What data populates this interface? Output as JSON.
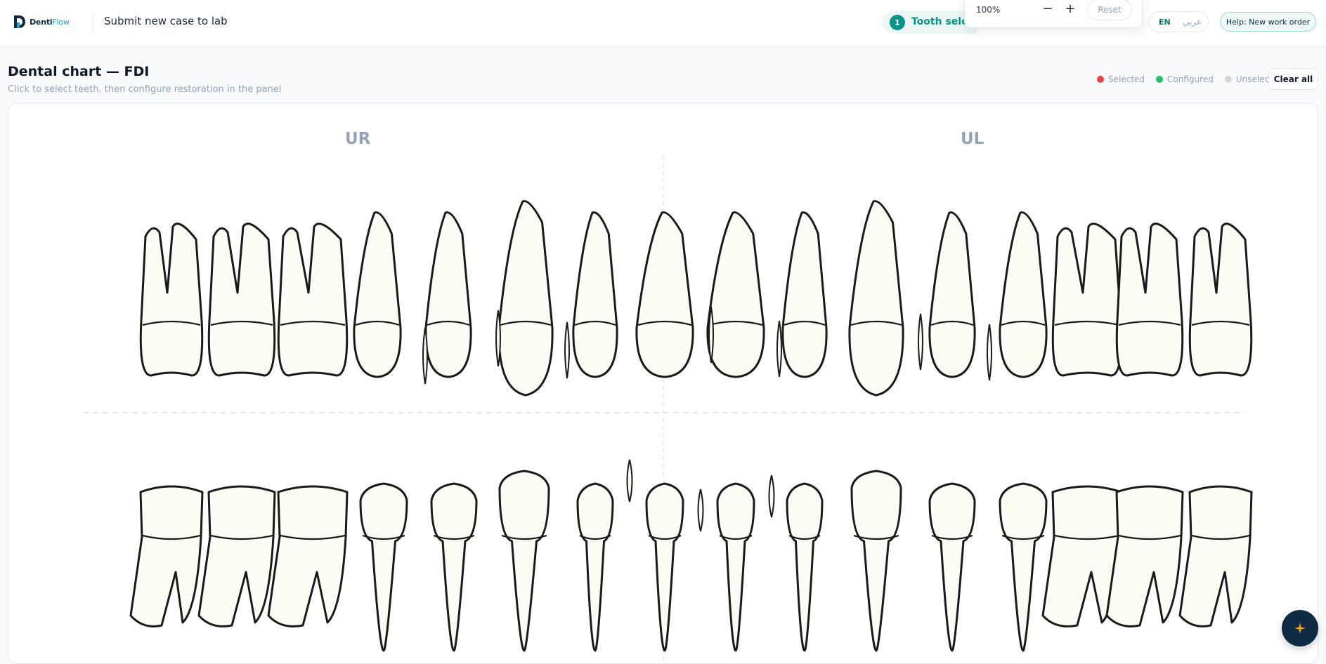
{
  "app": {
    "brand_part1": "Denti",
    "brand_part2": "Flow",
    "page_title": "Submit new case to lab"
  },
  "stepper": {
    "current_step": "1",
    "current_label": "Tooth selection"
  },
  "zoom": {
    "value": "100%",
    "minus_label": "−",
    "plus_label": "+",
    "reset_label": "Reset"
  },
  "language": {
    "en": "EN",
    "ar": "عربي"
  },
  "help": {
    "label": "Help: New work order"
  },
  "chart": {
    "title": "Dental chart — FDI",
    "subtitle": "Click to select teeth, then configure restoration in the panel",
    "legend": [
      {
        "label": "Selected",
        "color": "#ef4444"
      },
      {
        "label": "Configured",
        "color": "#22c55e"
      },
      {
        "label": "Unselected",
        "color": "#d1d5db"
      }
    ],
    "clear_label": "Clear all",
    "quadrant_upper_right": "UR",
    "quadrant_upper_left": "UL",
    "tooth_fill": "#fcfcf4",
    "tooth_stroke": "#1a1a1a"
  },
  "fab": {
    "icon": "sparkle-icon"
  }
}
